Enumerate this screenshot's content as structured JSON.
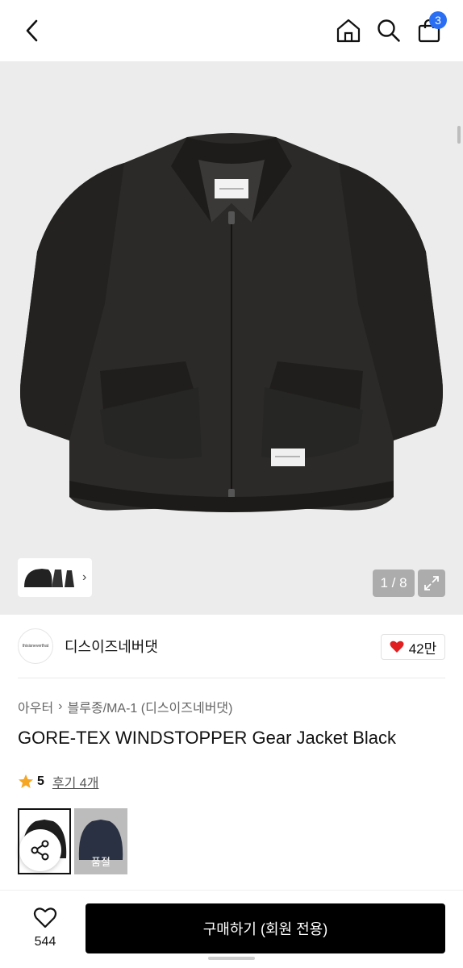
{
  "header": {
    "cart_badge": "3"
  },
  "gallery": {
    "counter": "1 / 8"
  },
  "brand": {
    "logo_text": "thisisneverthat",
    "name": "디스이즈네버댓",
    "like_count": "42만"
  },
  "product": {
    "breadcrumb": [
      "아우터",
      "블루종/MA-1 (디스이즈네버댓)"
    ],
    "title": "GORE-TEX WINDSTOPPER Gear Jacket Black",
    "rating": "5",
    "reviews": "후기 4개"
  },
  "variants": {
    "soldout_label": "품절"
  },
  "bottom": {
    "wish_count": "544",
    "buy_label": "구매하기 (회원 전용)"
  },
  "colors": {
    "accent": "#2a6ff3",
    "heart": "#e02020",
    "star": "#f5a623",
    "buy_bg": "#000000"
  }
}
